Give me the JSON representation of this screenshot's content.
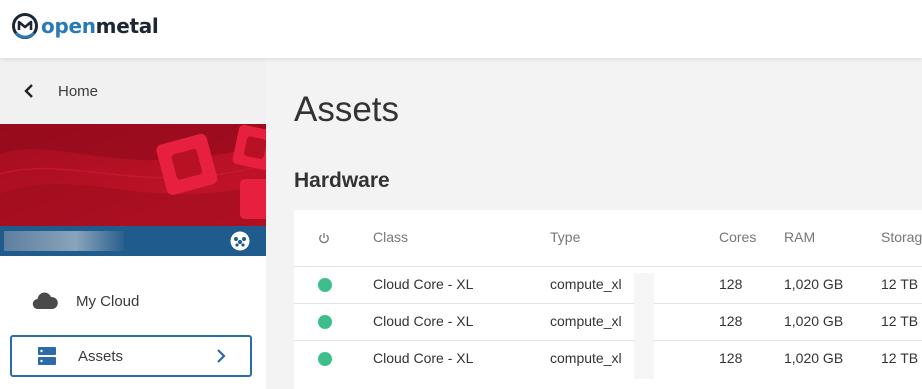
{
  "brand": {
    "open": "open",
    "metal": "metal"
  },
  "colors": {
    "brand_blue": "#2a7bb5",
    "brand_dark": "#1c2733",
    "banner_red": "#b81124",
    "userbar_blue": "#1f5b8c",
    "status_green": "#3dbf8b",
    "active_border": "#2b6ca8"
  },
  "sidebar": {
    "back_label": "Home",
    "nav": [
      {
        "label": "My Cloud",
        "icon": "cloud-icon"
      },
      {
        "label": "Assets",
        "icon": "server-icon",
        "active": true
      }
    ]
  },
  "main": {
    "title": "Assets",
    "section": "Hardware",
    "table": {
      "headers": {
        "status": "power-icon",
        "class": "Class",
        "type": "Type",
        "cores": "Cores",
        "ram": "RAM",
        "storage": "Storag"
      },
      "rows": [
        {
          "status": "online",
          "class": "Cloud Core - XL",
          "type": "compute_xl",
          "cores": "128",
          "ram": "1,020 GB",
          "storage": "12 TB"
        },
        {
          "status": "online",
          "class": "Cloud Core - XL",
          "type": "compute_xl",
          "cores": "128",
          "ram": "1,020 GB",
          "storage": "12 TB"
        },
        {
          "status": "online",
          "class": "Cloud Core - XL",
          "type": "compute_xl",
          "cores": "128",
          "ram": "1,020 GB",
          "storage": "12 TB"
        }
      ]
    }
  }
}
